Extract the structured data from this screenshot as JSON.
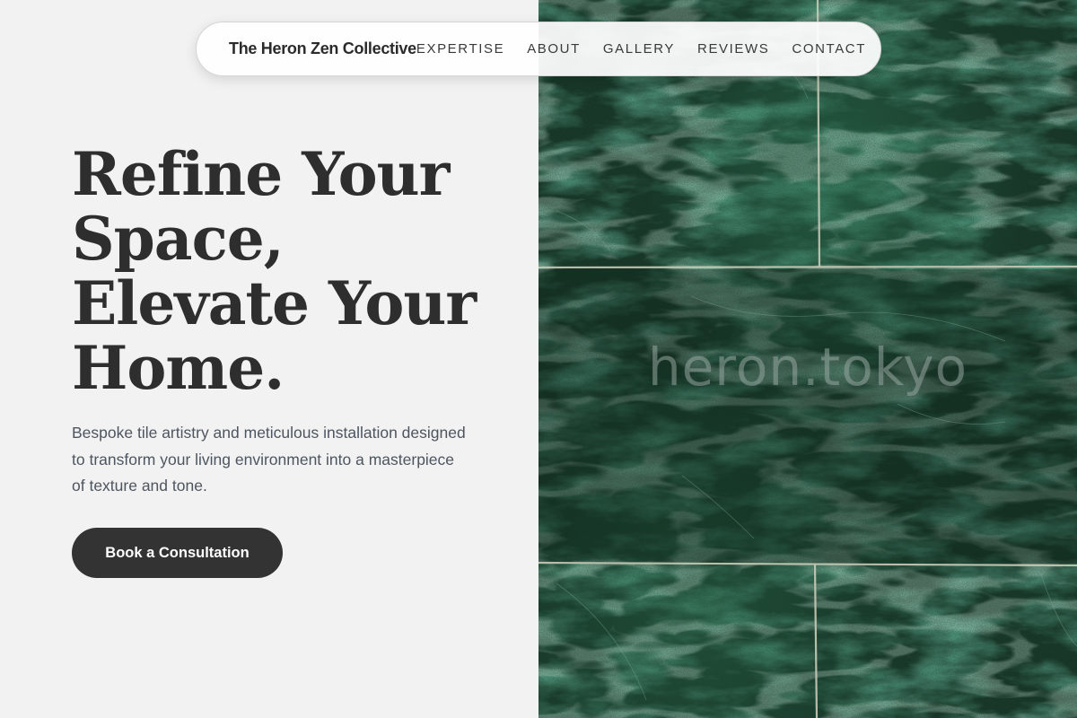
{
  "nav": {
    "brand": "The Heron Zen Collective",
    "links": [
      {
        "label": "EXPERTISE"
      },
      {
        "label": "ABOUT"
      },
      {
        "label": "GALLERY"
      },
      {
        "label": "REVIEWS"
      },
      {
        "label": "CONTACT"
      }
    ]
  },
  "hero": {
    "headline_lines": [
      "Refine Your",
      "Space,",
      "Elevate Your",
      "Home."
    ],
    "subtext": "Bespoke tile artistry and meticulous installation designed to transform your living environment into a masterpiece of texture and tone.",
    "cta_label": "Book a Consultation",
    "image": {
      "description": "green marble tile wall",
      "watermark": "heron.tokyo"
    }
  },
  "colors": {
    "background": "#f2f2f2",
    "text_dark": "#2e2e2e",
    "text_body": "#4d5560",
    "button": "#333333",
    "marble_green": "#1d3a2c"
  }
}
